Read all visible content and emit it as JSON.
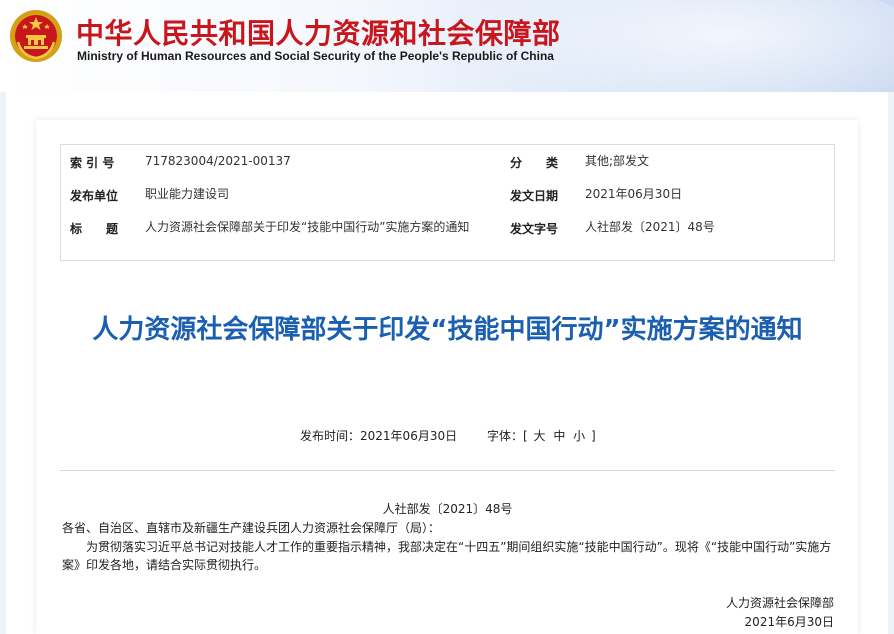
{
  "header": {
    "ministry_cn": "中华人民共和国人力资源和社会保障部",
    "ministry_en": "Ministry of Human Resources and Social Security of the People's Republic of China",
    "emblem_icon": "national-emblem-icon"
  },
  "meta": {
    "index_label": "索 引 号",
    "index_value": "717823004/2021-00137",
    "category_label": "分　　类",
    "category_value": "其他;部发文",
    "publisher_label": "发布单位",
    "publisher_value": "职业能力建设司",
    "date_label": "发文日期",
    "date_value": "2021年06月30日",
    "title_label": "标　　题",
    "title_value": "人力资源社会保障部关于印发“技能中国行动”实施方案的通知",
    "docno_label": "发文字号",
    "docno_value": "人社部发〔2021〕48号"
  },
  "article": {
    "title": "人力资源社会保障部关于印发“技能中国行动”实施方案的通知",
    "publish_time_label": "发布时间：",
    "publish_time": "2021年06月30日",
    "font_label": "字体：",
    "font_open": "[",
    "font_large": "大",
    "font_medium": "中",
    "font_small": "小",
    "font_close": "]",
    "doc_number": "人社部发〔2021〕48号",
    "addressee": "各省、自治区、直辖市及新疆生产建设兵团人力资源社会保障厅（局）：",
    "paragraph": "为贯彻落实习近平总书记对技能人才工作的重要指示精神，我部决定在“十四五”期间组织实施“技能中国行动”。现将《“技能中国行动”实施方案》印发各地，请结合实际贯彻执行。",
    "signature": "人力资源社会保障部",
    "sign_date": "2021年6月30日"
  },
  "colors": {
    "ministry_red": "#c8161d",
    "title_blue": "#1b5fb0"
  }
}
